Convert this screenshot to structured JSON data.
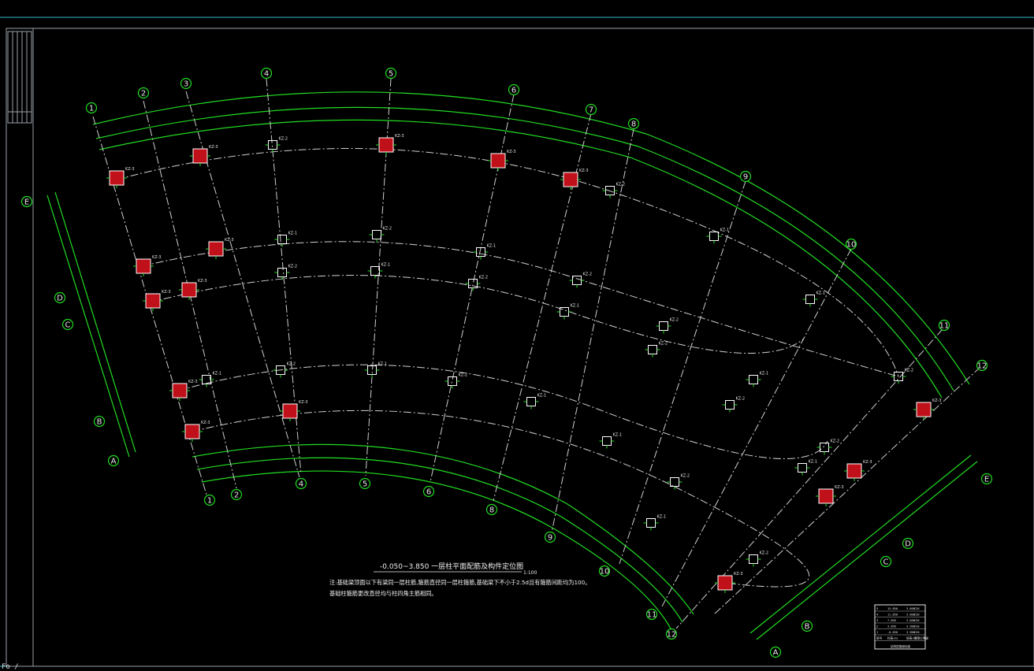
{
  "drawing": {
    "title_main": "-0.050~3.850 一层柱平面配筋及构件定位图",
    "title_scale": "1:100",
    "note_line1": "注:基础梁顶面以下有梁同一层柱筋,箍筋直径同一层柱箍筋,基础梁下不小于2.5d且有箍筋间距均为100。",
    "note_line2": "基础柱箍筋更改直径均与柱四角主筋相同。"
  },
  "axes": {
    "radial_top": [
      "1",
      "2",
      "3",
      "4",
      "5",
      "6",
      "7",
      "8",
      "9",
      "10",
      "11",
      "12"
    ],
    "radial_bottom": [
      "1",
      "2",
      "4",
      "5",
      "6",
      "8",
      "9",
      "10",
      "11",
      "12"
    ],
    "arc_left": [
      "E",
      "D",
      "C",
      "B",
      "A"
    ],
    "arc_right": [
      "E",
      "D",
      "C",
      "B",
      "A"
    ]
  },
  "columns": {
    "kz1": "KZ-1",
    "kz2": "KZ-2",
    "kz3": "KZ-3"
  },
  "status": {
    "coords": "Fo /"
  },
  "level_table": {
    "rows": [
      [
        "5",
        "15.850",
        "3.600",
        "C30"
      ],
      [
        "4",
        "11.850",
        "3.600",
        "C30"
      ],
      [
        "3",
        "7.850",
        "3.600",
        "C30"
      ],
      [
        "2",
        "3.850",
        "3.900",
        "C30"
      ],
      [
        "1",
        "-0.050",
        "3.900",
        "C30"
      ],
      [
        "层号",
        "标高(m)",
        "层高(m)",
        "混凝土等级"
      ]
    ],
    "caption": "结构层楼面标高"
  },
  "colors": {
    "background": "#000000",
    "grid": "#22dd22",
    "beam": "#cfcfcf",
    "column_fill": "#c0101a",
    "border": "#2fb7c7"
  }
}
